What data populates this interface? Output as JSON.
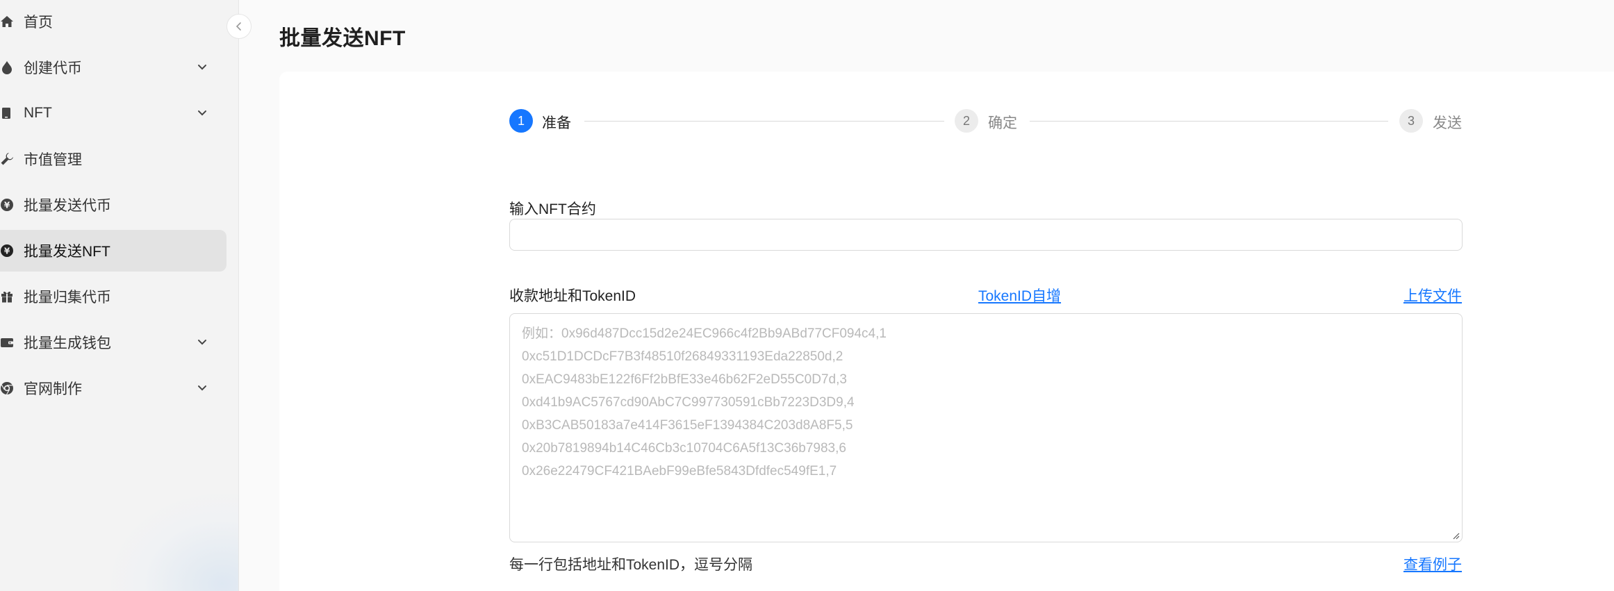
{
  "sidebar": {
    "items": [
      {
        "label": "首页",
        "icon": "home-icon",
        "has_submenu": false,
        "active": false
      },
      {
        "label": "创建代币",
        "icon": "fire-drop-icon",
        "has_submenu": true,
        "active": false
      },
      {
        "label": "NFT",
        "icon": "tablet-icon",
        "has_submenu": true,
        "active": false
      },
      {
        "label": "市值管理",
        "icon": "wrench-icon",
        "has_submenu": false,
        "active": false
      },
      {
        "label": "批量发送代币",
        "icon": "yen-coin-icon",
        "has_submenu": false,
        "active": false
      },
      {
        "label": "批量发送NFT",
        "icon": "yen-coin-icon",
        "has_submenu": false,
        "active": true
      },
      {
        "label": "批量归集代币",
        "icon": "gift-icon",
        "has_submenu": false,
        "active": false
      },
      {
        "label": "批量生成钱包",
        "icon": "wallet-icon",
        "has_submenu": true,
        "active": false
      },
      {
        "label": "官网制作",
        "icon": "chrome-icon",
        "has_submenu": true,
        "active": false
      }
    ]
  },
  "header": {
    "title": "批量发送NFT"
  },
  "steps": [
    {
      "number": "1",
      "label": "准备",
      "status": "active"
    },
    {
      "number": "2",
      "label": "确定",
      "status": "inactive"
    },
    {
      "number": "3",
      "label": "发送",
      "status": "inactive"
    }
  ],
  "form": {
    "contract_label": "输入NFT合约",
    "contract_value": "",
    "recipients_label": "收款地址和TokenID",
    "tokenid_increment_link": "TokenID自增",
    "upload_file_link": "上传文件",
    "recipients_placeholder_lines": [
      "例如：0x96d487Dcc15d2e24EC966c4f2Bb9ABd77CF094c4,1",
      "0xc51D1DCDcF7B3f48510f26849331193Eda22850d,2",
      "0xEAC9483bE122f6Ff2bBfE33e46b62F2eD55C0D7d,3",
      "0xd41b9AC5767cd90AbC7C997730591cBb7223D3D9,4",
      "0xB3CAB50183a7e414F3615eF1394384C203d8A8F5,5",
      "0x20b7819894b14C46Cb3c10704C6A5f13C36b7983,6",
      "0x26e22479CF421BAebF99eBfe5843Dfdfec549fE1,7"
    ],
    "helper_text": "每一行包括地址和TokenID，逗号分隔",
    "view_example_link": "查看例子"
  },
  "colors": {
    "accent": "#1677ff",
    "sidebar_bg": "#f3f3f3",
    "active_item_bg": "#e3e3e3"
  }
}
